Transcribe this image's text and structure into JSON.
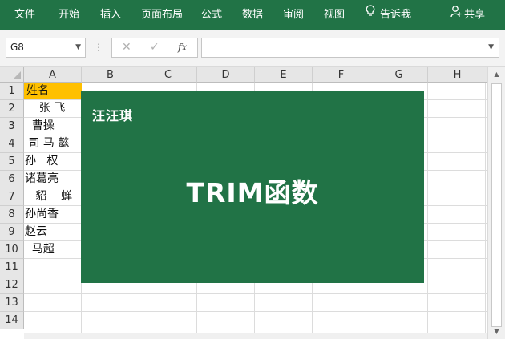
{
  "ribbon": {
    "tabs": [
      "文件",
      "开始",
      "插入",
      "页面布局",
      "公式",
      "数据",
      "审阅",
      "视图"
    ],
    "tell_me": "告诉我",
    "share": "共享",
    "tell_me_icon": "lightbulb-icon",
    "share_icon": "person-icon",
    "color": "#217346"
  },
  "formula_bar": {
    "name_box": "G8",
    "cancel_symbol": "✕",
    "enter_symbol": "✓",
    "function_symbol": "fx",
    "formula_value": ""
  },
  "sheet": {
    "columns": [
      "A",
      "B",
      "C",
      "D",
      "E",
      "F",
      "G",
      "H"
    ],
    "rows": [
      "1",
      "2",
      "3",
      "4",
      "5",
      "6",
      "7",
      "8",
      "9",
      "10",
      "11",
      "12",
      "13",
      "14"
    ],
    "column_a_values": [
      "姓名",
      "    张 飞",
      "  曹操",
      " 司 马 懿",
      "孙   权",
      "诸葛亮",
      "   貂    蝉",
      "孙尚香",
      "赵云",
      "  马超"
    ],
    "header_fill": "#ffc000"
  },
  "overlay": {
    "brand": "汪汪琪",
    "title": "TRIM函数",
    "color": "#217346"
  }
}
